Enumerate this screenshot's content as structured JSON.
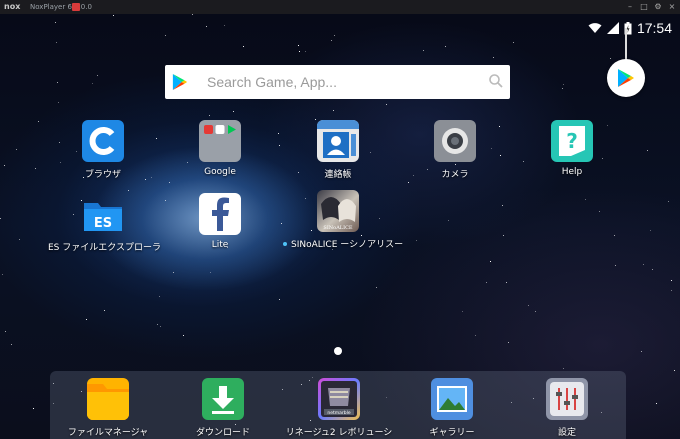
{
  "window": {
    "logo": "nox",
    "title": "NoxPlayer 6.0.0.0",
    "controls": [
      "–",
      "□",
      "⚙",
      "×"
    ]
  },
  "status_bar": {
    "time": "17:54",
    "icons": [
      "wifi-icon",
      "signal-icon",
      "battery-icon"
    ]
  },
  "search": {
    "placeholder": "Search Game, App..."
  },
  "fab": {
    "icon": "play-store-icon"
  },
  "apps": [
    {
      "label": "ブラウザ",
      "icon": "browser-icon"
    },
    {
      "label": "Google",
      "icon": "google-folder-icon"
    },
    {
      "label": "連絡帳",
      "icon": "contacts-icon"
    },
    {
      "label": "カメラ",
      "icon": "camera-icon"
    },
    {
      "label": "Help",
      "icon": "help-icon"
    },
    {
      "label": "ES ファイルエクスプローラ",
      "icon": "es-file-explorer-icon"
    },
    {
      "label": "Lite",
      "icon": "facebook-icon"
    },
    {
      "label": "SINoALICE ーシノアリスー",
      "icon": "sinoalice-icon"
    }
  ],
  "dock": [
    {
      "label": "ファイルマネージャ",
      "icon": "folder-icon"
    },
    {
      "label": "ダウンロード",
      "icon": "download-icon"
    },
    {
      "label": "リネージュ2 レボリューシ",
      "icon": "lineage2-icon"
    },
    {
      "label": "ギャラリー",
      "icon": "gallery-icon"
    },
    {
      "label": "設定",
      "icon": "settings-icon"
    }
  ],
  "colors": {
    "accent_play": "#00c853",
    "browser": "#1e88e5",
    "help": "#26c6b5",
    "download": "#2eae5e",
    "folder": "#ffb300",
    "gallery": "#4f8fe0",
    "settings": "#8f95a8"
  },
  "page_indicator": {
    "count": 1,
    "active": 0
  }
}
